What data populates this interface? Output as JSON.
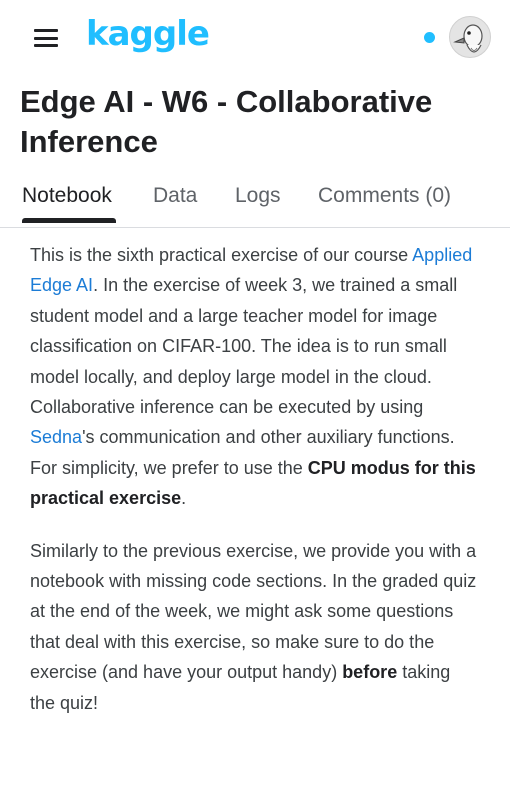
{
  "header": {
    "logo_text": "kaggle",
    "brand_color": "#20beff",
    "menu_icon": "hamburger-menu-icon",
    "notification_icon": "notification-dot-icon",
    "avatar_icon": "user-avatar-icon"
  },
  "page": {
    "title": "Edge AI - W6 - Collaborative Inference"
  },
  "tabs": [
    {
      "label": "Notebook",
      "active": true
    },
    {
      "label": "Data",
      "active": false
    },
    {
      "label": "Logs",
      "active": false
    },
    {
      "label": "Comments (0)",
      "active": false
    }
  ],
  "content": {
    "p1": {
      "t1": "This is the sixth practical exercise of our course ",
      "link1": "Applied Edge AI",
      "t2": ". In the exercise of week 3, we trained a small student model and a large teacher model for image classification on CIFAR-100. The idea is to run small model locally, and deploy large model in the cloud. Collaborative inference can be executed by using ",
      "link2": "Sedna",
      "t3": "'s communication and other auxiliary functions. For simplicity, we prefer to use the ",
      "bold1": "CPU modus for this practical exercise",
      "t4": "."
    },
    "p2": {
      "t1": "Similarly to the previous exercise, we provide you with a notebook with missing code sections. In the graded quiz at the end of the week, we might ask some questions that deal with this exercise, so make sure to do the exercise (and have your output handy) ",
      "bold1": "before",
      "t2": " taking the quiz!"
    }
  }
}
